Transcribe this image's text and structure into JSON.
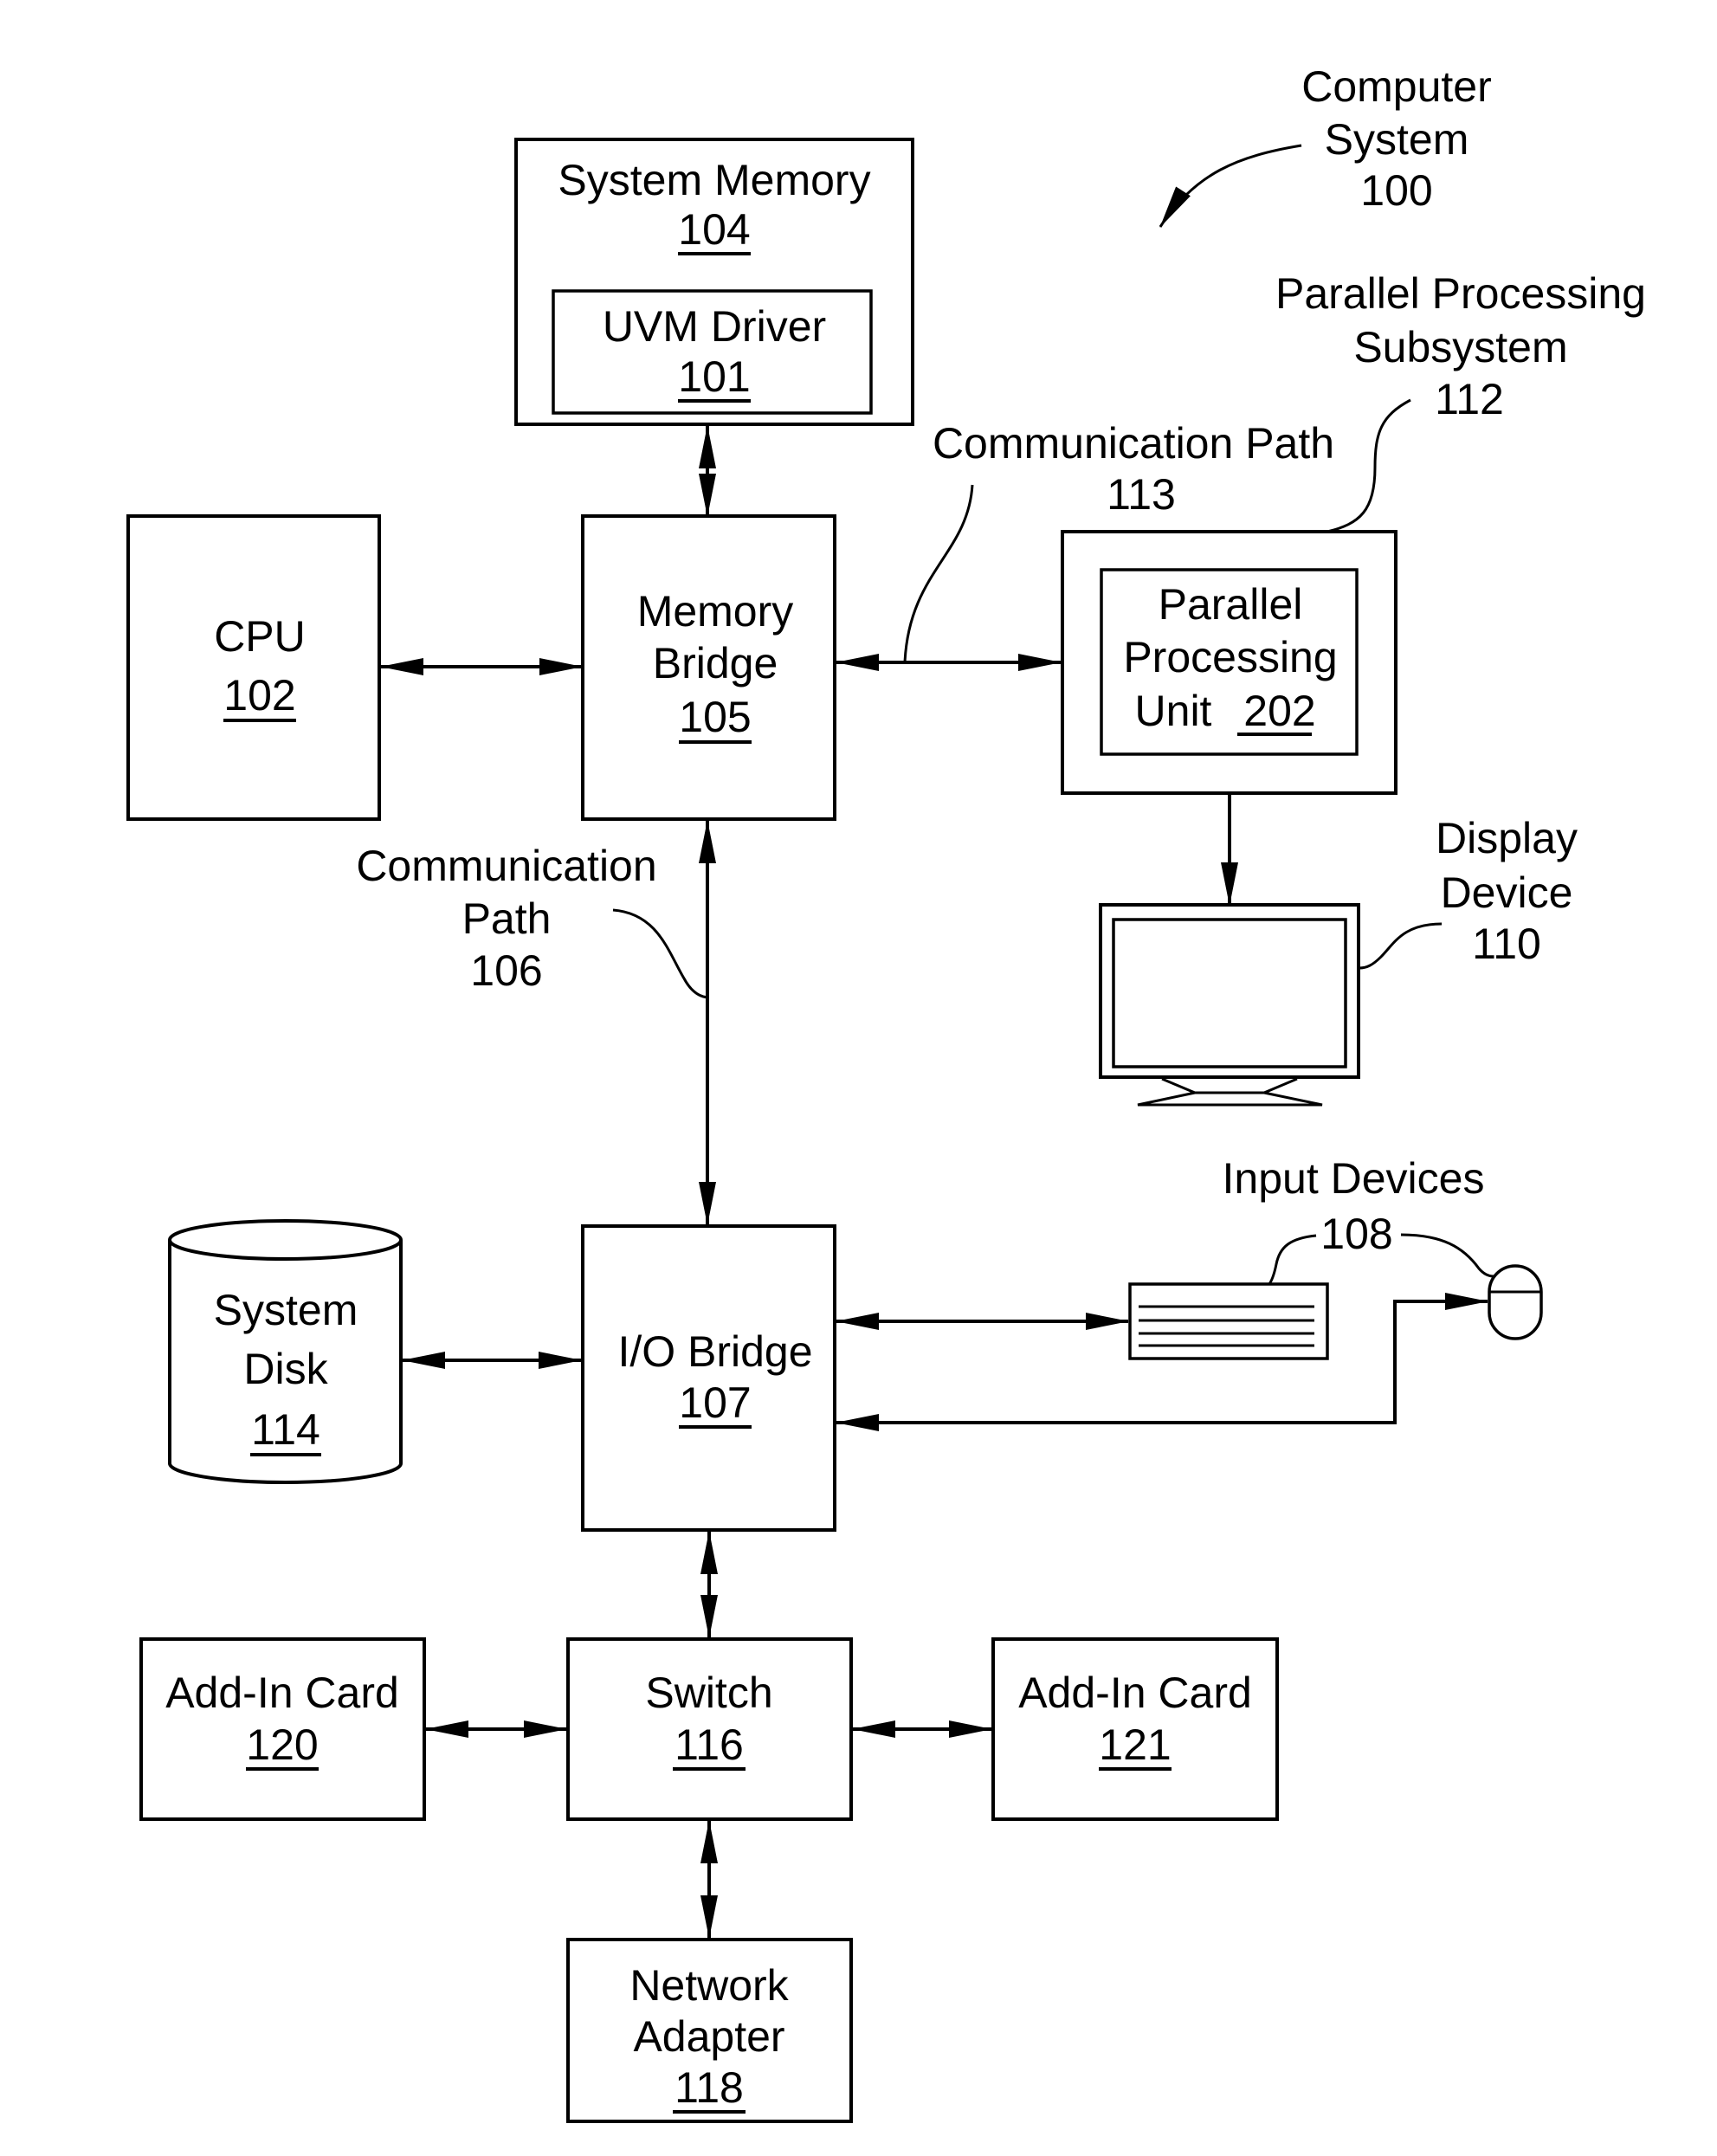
{
  "figure": {
    "title_label": {
      "lines": [
        "Computer",
        "System",
        "100"
      ]
    },
    "colors": {
      "stroke": "#000000",
      "background": "#ffffff"
    }
  },
  "components": {
    "system_memory": {
      "name": "System Memory",
      "ref": "104"
    },
    "uvm_driver": {
      "name": "UVM Driver",
      "ref": "101"
    },
    "cpu": {
      "name": "CPU",
      "ref": "102"
    },
    "memory_bridge": {
      "name_lines": [
        "Memory",
        "Bridge"
      ],
      "ref": "105"
    },
    "parallel_processing_subsystem": {
      "name_lines": [
        "Parallel Processing",
        "Subsystem"
      ],
      "ref": "112"
    },
    "parallel_processing_unit": {
      "name_lines": [
        "Parallel",
        "Processing",
        "Unit"
      ],
      "ref": "202"
    },
    "display_device": {
      "name_lines": [
        "Display",
        "Device"
      ],
      "ref": "110"
    },
    "input_devices": {
      "name": "Input Devices",
      "ref": "108"
    },
    "io_bridge": {
      "name": "I/O Bridge",
      "ref": "107"
    },
    "system_disk": {
      "name_lines": [
        "System",
        "Disk"
      ],
      "ref": "114"
    },
    "switch": {
      "name": "Switch",
      "ref": "116"
    },
    "add_in_card_1": {
      "name": "Add-In Card",
      "ref": "120"
    },
    "add_in_card_2": {
      "name": "Add-In Card",
      "ref": "121"
    },
    "network_adapter": {
      "name_lines": [
        "Network",
        "Adapter"
      ],
      "ref": "118"
    }
  },
  "paths": {
    "comm_path_113": {
      "name": "Communication Path",
      "ref": "113"
    },
    "comm_path_106": {
      "name_lines": [
        "Communication",
        "Path"
      ],
      "ref": "106"
    }
  },
  "connections": [
    {
      "from": "System Memory 104",
      "to": "Memory Bridge 105",
      "direction": "bidirectional"
    },
    {
      "from": "CPU 102",
      "to": "Memory Bridge 105",
      "direction": "bidirectional"
    },
    {
      "from": "Memory Bridge 105",
      "to": "Parallel Processing Subsystem 112",
      "direction": "bidirectional",
      "via": "Communication Path 113"
    },
    {
      "from": "Parallel Processing Subsystem 112",
      "to": "Display Device 110",
      "direction": "one-way"
    },
    {
      "from": "Memory Bridge 105",
      "to": "I/O Bridge 107",
      "direction": "bidirectional",
      "via": "Communication Path 106"
    },
    {
      "from": "System Disk 114",
      "to": "I/O Bridge 107",
      "direction": "bidirectional"
    },
    {
      "from": "I/O Bridge 107",
      "to": "Input Devices 108 (keyboard)",
      "direction": "bidirectional"
    },
    {
      "from": "I/O Bridge 107",
      "to": "Input Devices 108 (mouse)",
      "direction": "bidirectional"
    },
    {
      "from": "I/O Bridge 107",
      "to": "Switch 116",
      "direction": "bidirectional"
    },
    {
      "from": "Add-In Card 120",
      "to": "Switch 116",
      "direction": "bidirectional"
    },
    {
      "from": "Switch 116",
      "to": "Add-In Card 121",
      "direction": "bidirectional"
    },
    {
      "from": "Switch 116",
      "to": "Network Adapter 118",
      "direction": "bidirectional"
    }
  ]
}
